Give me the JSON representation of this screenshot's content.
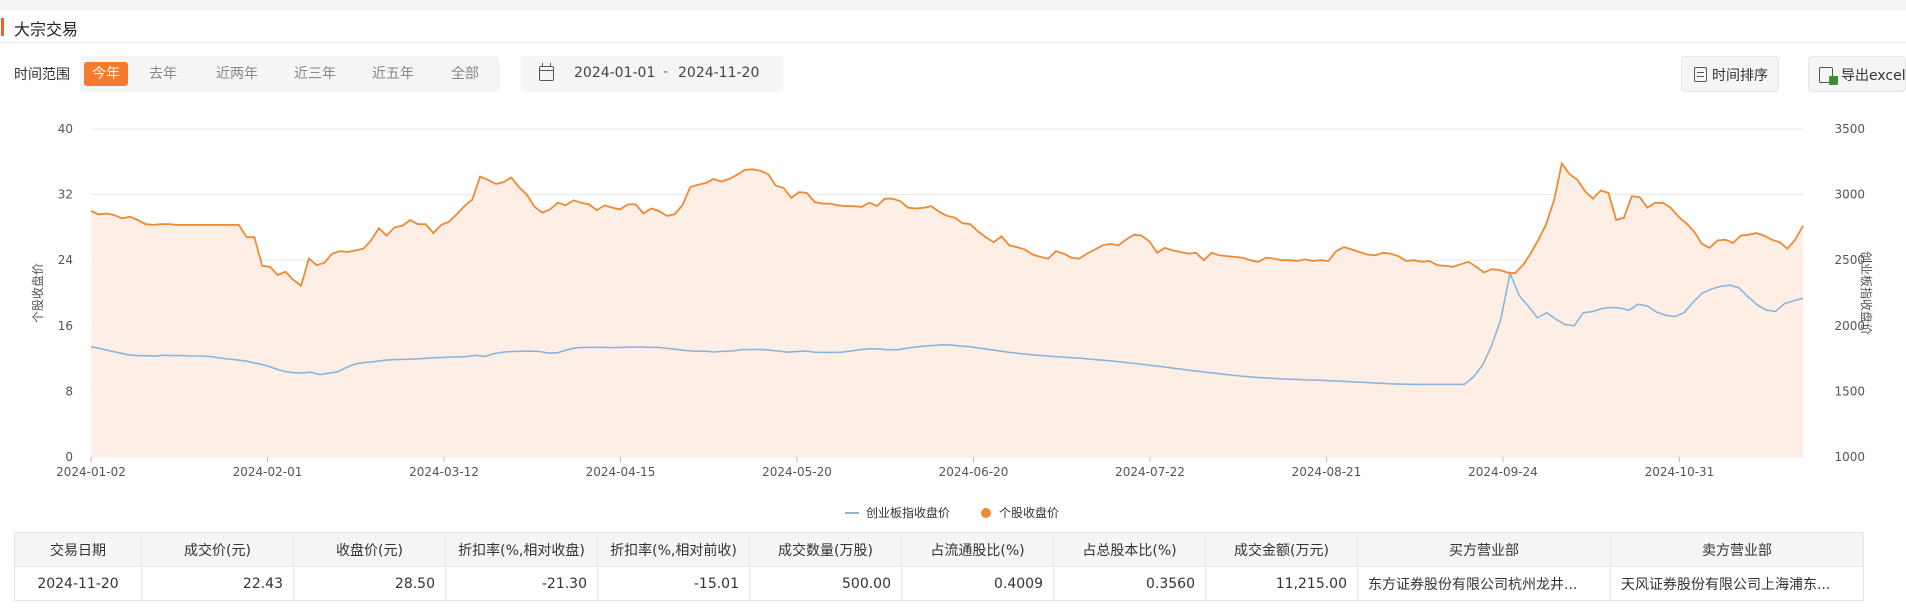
{
  "panel": {
    "title": "大宗交易"
  },
  "filter": {
    "label": "时间范围",
    "ranges": [
      "今年",
      "去年",
      "近两年",
      "近三年",
      "近五年",
      "全部"
    ],
    "active_index": 0,
    "date_start": "2024-01-01",
    "date_sep": "-",
    "date_end": "2024-11-20"
  },
  "toolbar": {
    "sort_label": "时间排序",
    "export_label": "导出excel"
  },
  "colors": {
    "accent": "#f47a2e",
    "stock_line": "#ee8a33",
    "index_line": "#8db5db",
    "area_fill": "#fdece0"
  },
  "chart_data": {
    "type": "line",
    "x_ticks": [
      "2024-01-02",
      "2024-02-01",
      "2024-03-12",
      "2024-04-15",
      "2024-05-20",
      "2024-06-20",
      "2024-07-22",
      "2024-08-21",
      "2024-09-24",
      "2024-10-31"
    ],
    "y_left": {
      "label": "个股收盘价",
      "ticks": [
        0,
        8,
        16,
        24,
        32,
        40
      ],
      "range": [
        0,
        40
      ]
    },
    "y_right": {
      "label": "创业板指收盘价",
      "ticks": [
        1000,
        1500,
        2000,
        2500,
        3000,
        3500
      ],
      "range": [
        1000,
        3500
      ]
    },
    "grid": true,
    "legend_position": "bottom",
    "series": [
      {
        "name": "创业板指收盘价",
        "axis": "right",
        "style": "line",
        "values": [
          1840,
          1827,
          1810,
          1795,
          1780,
          1772,
          1772,
          1769,
          1776,
          1773,
          1773,
          1770,
          1770,
          1767,
          1755,
          1747,
          1740,
          1730,
          1715,
          1700,
          1677,
          1654,
          1643,
          1640,
          1646,
          1629,
          1639,
          1651,
          1686,
          1711,
          1721,
          1727,
          1737,
          1742,
          1743,
          1746,
          1749,
          1754,
          1758,
          1761,
          1763,
          1765,
          1775,
          1766,
          1787,
          1799,
          1804,
          1806,
          1807,
          1804,
          1791,
          1795,
          1817,
          1832,
          1835,
          1836,
          1836,
          1833,
          1835,
          1838,
          1838,
          1836,
          1835,
          1827,
          1820,
          1812,
          1806,
          1807,
          1800,
          1806,
          1808,
          1818,
          1819,
          1820,
          1815,
          1808,
          1799,
          1803,
          1807,
          1799,
          1797,
          1797,
          1799,
          1807,
          1818,
          1825,
          1825,
          1818,
          1817,
          1828,
          1838,
          1845,
          1850,
          1855,
          1853,
          1846,
          1841,
          1830,
          1821,
          1810,
          1801,
          1792,
          1785,
          1778,
          1772,
          1767,
          1762,
          1758,
          1753,
          1747,
          1741,
          1735,
          1728,
          1721,
          1713,
          1705,
          1696,
          1688,
          1679,
          1670,
          1661,
          1653,
          1645,
          1637,
          1628,
          1621,
          1614,
          1608,
          1604,
          1600,
          1596,
          1593,
          1590,
          1587,
          1585,
          1582,
          1579,
          1576,
          1572,
          1569,
          1565,
          1562,
          1558,
          1556,
          1554,
          1553,
          1553,
          1553,
          1553,
          1553,
          1553,
          1610,
          1700,
          1850,
          2050,
          2400,
          2230,
          2150,
          2060,
          2100,
          2050,
          2010,
          2000,
          2100,
          2108,
          2130,
          2140,
          2135,
          2120,
          2165,
          2150,
          2105,
          2080,
          2070,
          2100,
          2180,
          2250,
          2280,
          2300,
          2310,
          2290,
          2220,
          2160,
          2120,
          2110,
          2170,
          2190,
          2210
        ]
      },
      {
        "name": "个股收盘价",
        "axis": "left",
        "style": "area",
        "values": [
          30.0,
          29.6,
          29.7,
          29.5,
          29.1,
          29.3,
          28.9,
          28.4,
          28.3,
          28.4,
          28.4,
          28.3,
          28.3,
          28.3,
          28.3,
          28.3,
          28.3,
          28.3,
          28.3,
          28.3,
          26.8,
          26.8,
          23.3,
          23.2,
          22.2,
          22.6,
          21.6,
          20.9,
          24.2,
          23.4,
          23.7,
          24.8,
          25.1,
          25.0,
          25.2,
          25.4,
          26.4,
          27.9,
          27.0,
          28.0,
          28.2,
          28.9,
          28.4,
          28.4,
          27.3,
          28.3,
          28.7,
          29.6,
          30.6,
          31.4,
          34.2,
          33.8,
          33.3,
          33.5,
          34.1,
          32.9,
          32.0,
          30.5,
          29.8,
          30.2,
          31.0,
          30.7,
          31.3,
          31.0,
          30.8,
          30.1,
          30.7,
          30.4,
          30.2,
          30.8,
          30.8,
          29.7,
          30.3,
          30.0,
          29.4,
          29.6,
          30.7,
          32.9,
          33.2,
          33.4,
          33.9,
          33.6,
          33.9,
          34.4,
          35.0,
          35.1,
          34.9,
          34.5,
          33.1,
          32.8,
          31.6,
          32.3,
          32.2,
          31.1,
          30.9,
          30.9,
          30.7,
          30.6,
          30.6,
          30.5,
          31.0,
          30.6,
          31.5,
          31.5,
          31.2,
          30.4,
          30.3,
          30.4,
          30.6,
          29.9,
          29.4,
          29.2,
          28.5,
          28.4,
          27.5,
          26.8,
          26.2,
          26.9,
          25.8,
          25.6,
          25.3,
          24.7,
          24.4,
          24.2,
          25.1,
          24.8,
          24.3,
          24.2,
          24.8,
          25.3,
          25.8,
          26.0,
          25.8,
          26.5,
          27.1,
          27.0,
          26.3,
          24.9,
          25.5,
          25.2,
          25.0,
          24.8,
          24.9,
          24.0,
          24.9,
          24.6,
          24.5,
          24.4,
          24.3,
          24.0,
          23.8,
          24.3,
          24.2,
          24.0,
          24.0,
          23.9,
          24.1,
          23.9,
          24.0,
          23.9,
          25.1,
          25.6,
          25.3,
          25.0,
          24.7,
          24.6,
          24.9,
          24.8,
          24.5,
          23.9,
          24.0,
          23.8,
          23.9,
          23.4,
          23.3,
          23.2,
          23.5,
          23.8,
          23.2,
          22.5,
          22.9,
          22.8,
          22.5,
          22.4,
          23.4,
          24.8,
          26.5,
          28.4,
          31.3,
          35.8,
          34.5,
          33.8,
          32.4,
          31.5,
          32.5,
          32.2,
          28.9,
          29.2,
          31.8,
          31.7,
          30.4,
          31.0,
          31.0,
          30.4,
          29.3,
          28.5,
          27.5,
          26.0,
          25.5,
          26.4,
          26.5,
          26.1,
          27.0,
          27.1,
          27.3,
          27.0,
          26.5,
          26.2,
          25.4,
          26.5,
          28.2
        ]
      }
    ]
  },
  "table": {
    "headers": [
      "交易日期",
      "成交价(元)",
      "收盘价(元)",
      "折扣率(%,相对收盘)",
      "折扣率(%,相对前收)",
      "成交数量(万股)",
      "占流通股比(%)",
      "占总股本比(%)",
      "成交金额(万元)",
      "买方营业部",
      "卖方营业部"
    ],
    "rows": [
      [
        "2024-11-20",
        "22.43",
        "28.50",
        "-21.30",
        "-15.01",
        "500.00",
        "0.4009",
        "0.3560",
        "11,215.00",
        "东方证券股份有限公司杭州龙井...",
        "天风证券股份有限公司上海浦东..."
      ]
    ]
  }
}
